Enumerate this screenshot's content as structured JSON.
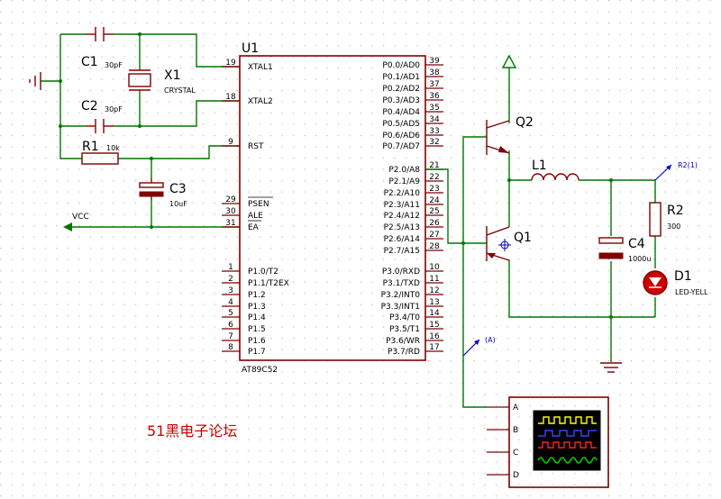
{
  "chip": {
    "ref": "U1",
    "part": "AT89C52",
    "left_pins": [
      {
        "num": "19",
        "name": "XTAL1"
      },
      {
        "num": "18",
        "name": "XTAL2"
      },
      {
        "num": "9",
        "name": "RST"
      },
      {
        "num": "29",
        "name": "PSEN"
      },
      {
        "num": "30",
        "name": "ALE"
      },
      {
        "num": "31",
        "name": "EA"
      },
      {
        "num": "1",
        "name": "P1.0/T2"
      },
      {
        "num": "2",
        "name": "P1.1/T2EX"
      },
      {
        "num": "3",
        "name": "P1.2"
      },
      {
        "num": "4",
        "name": "P1.3"
      },
      {
        "num": "5",
        "name": "P1.4"
      },
      {
        "num": "6",
        "name": "P1.5"
      },
      {
        "num": "7",
        "name": "P1.6"
      },
      {
        "num": "8",
        "name": "P1.7"
      }
    ],
    "right_pins": [
      {
        "num": "39",
        "name": "P0.0/AD0"
      },
      {
        "num": "38",
        "name": "P0.1/AD1"
      },
      {
        "num": "37",
        "name": "P0.2/AD2"
      },
      {
        "num": "36",
        "name": "P0.3/AD3"
      },
      {
        "num": "35",
        "name": "P0.4/AD4"
      },
      {
        "num": "34",
        "name": "P0.5/AD5"
      },
      {
        "num": "33",
        "name": "P0.6/AD6"
      },
      {
        "num": "32",
        "name": "P0.7/AD7"
      },
      {
        "num": "21",
        "name": "P2.0/A8"
      },
      {
        "num": "22",
        "name": "P2.1/A9"
      },
      {
        "num": "23",
        "name": "P2.2/A10"
      },
      {
        "num": "24",
        "name": "P2.3/A11"
      },
      {
        "num": "25",
        "name": "P2.4/A12"
      },
      {
        "num": "26",
        "name": "P2.5/A13"
      },
      {
        "num": "27",
        "name": "P2.6/A14"
      },
      {
        "num": "28",
        "name": "P2.7/A15"
      },
      {
        "num": "10",
        "name": "P3.0/RXD"
      },
      {
        "num": "11",
        "name": "P3.1/TXD"
      },
      {
        "num": "12",
        "name": "P3.2/INT0"
      },
      {
        "num": "13",
        "name": "P3.3/INT1"
      },
      {
        "num": "14",
        "name": "P3.4/T0"
      },
      {
        "num": "15",
        "name": "P3.5/T1"
      },
      {
        "num": "16",
        "name": "P3.6/WR"
      },
      {
        "num": "17",
        "name": "P3.7/RD"
      }
    ]
  },
  "components": {
    "c1": {
      "ref": "C1",
      "value": "30pF"
    },
    "c2": {
      "ref": "C2",
      "value": "30pF"
    },
    "x1": {
      "ref": "X1",
      "value": "CRYSTAL"
    },
    "r1": {
      "ref": "R1",
      "value": "10k"
    },
    "c3": {
      "ref": "C3",
      "value": "10uF"
    },
    "q1": {
      "ref": "Q1"
    },
    "q2": {
      "ref": "Q2"
    },
    "l1": {
      "ref": "L1"
    },
    "c4": {
      "ref": "C4",
      "value": "1000u"
    },
    "r2": {
      "ref": "R2",
      "value": "300"
    },
    "d1": {
      "ref": "D1",
      "value": "LED-YELL"
    }
  },
  "labels": {
    "vcc": "VCC",
    "probe_a": "(A)",
    "probe_r2": "R2(1)"
  },
  "scope": {
    "channels": [
      "A",
      "B",
      "C",
      "D"
    ]
  },
  "watermark": "51黑电子论坛",
  "colors": {
    "wire": "#007700",
    "component": "#800000",
    "grid": "#c0c0c0",
    "watermark": "#cc0000",
    "probe": "#0000cc"
  }
}
